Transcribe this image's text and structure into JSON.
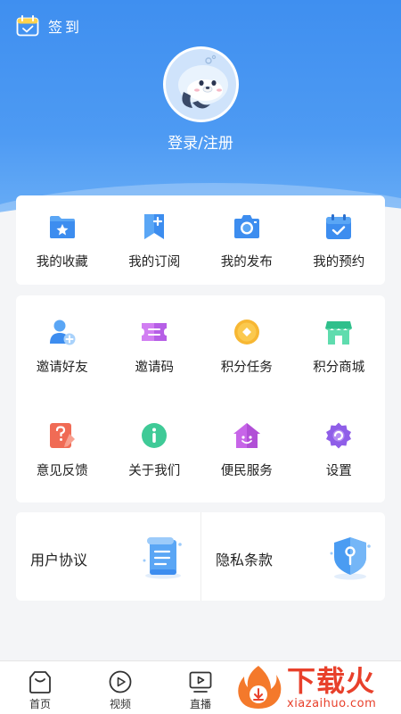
{
  "header": {
    "signin_label": "签到",
    "login_text": "登录/注册"
  },
  "quick_menu": [
    {
      "label": "我的收藏",
      "icon": "folder-star-icon"
    },
    {
      "label": "我的订阅",
      "icon": "bookmark-plus-icon"
    },
    {
      "label": "我的发布",
      "icon": "camera-icon"
    },
    {
      "label": "我的预约",
      "icon": "calendar-check-icon"
    }
  ],
  "services": [
    {
      "label": "邀请好友",
      "icon": "add-user-icon"
    },
    {
      "label": "邀请码",
      "icon": "ticket-icon"
    },
    {
      "label": "积分任务",
      "icon": "coin-icon"
    },
    {
      "label": "积分商城",
      "icon": "store-icon"
    },
    {
      "label": "意见反馈",
      "icon": "feedback-icon"
    },
    {
      "label": "关于我们",
      "icon": "info-icon"
    },
    {
      "label": "便民服务",
      "icon": "home-heart-icon"
    },
    {
      "label": "设置",
      "icon": "gear-icon"
    }
  ],
  "policies": [
    {
      "label": "用户协议",
      "icon": "document-icon"
    },
    {
      "label": "隐私条款",
      "icon": "shield-icon"
    }
  ],
  "tabbar": [
    {
      "label": "首页",
      "icon": "home-bag-icon"
    },
    {
      "label": "视频",
      "icon": "play-circle-icon"
    },
    {
      "label": "直播",
      "icon": "tv-play-icon"
    }
  ],
  "watermark": {
    "title": "下载火",
    "url": "xiazaihuo.com"
  },
  "colors": {
    "header_blue": "#3f8ff0",
    "accent_blue": "#4a9cf2",
    "watermark_red": "#e8402b"
  }
}
